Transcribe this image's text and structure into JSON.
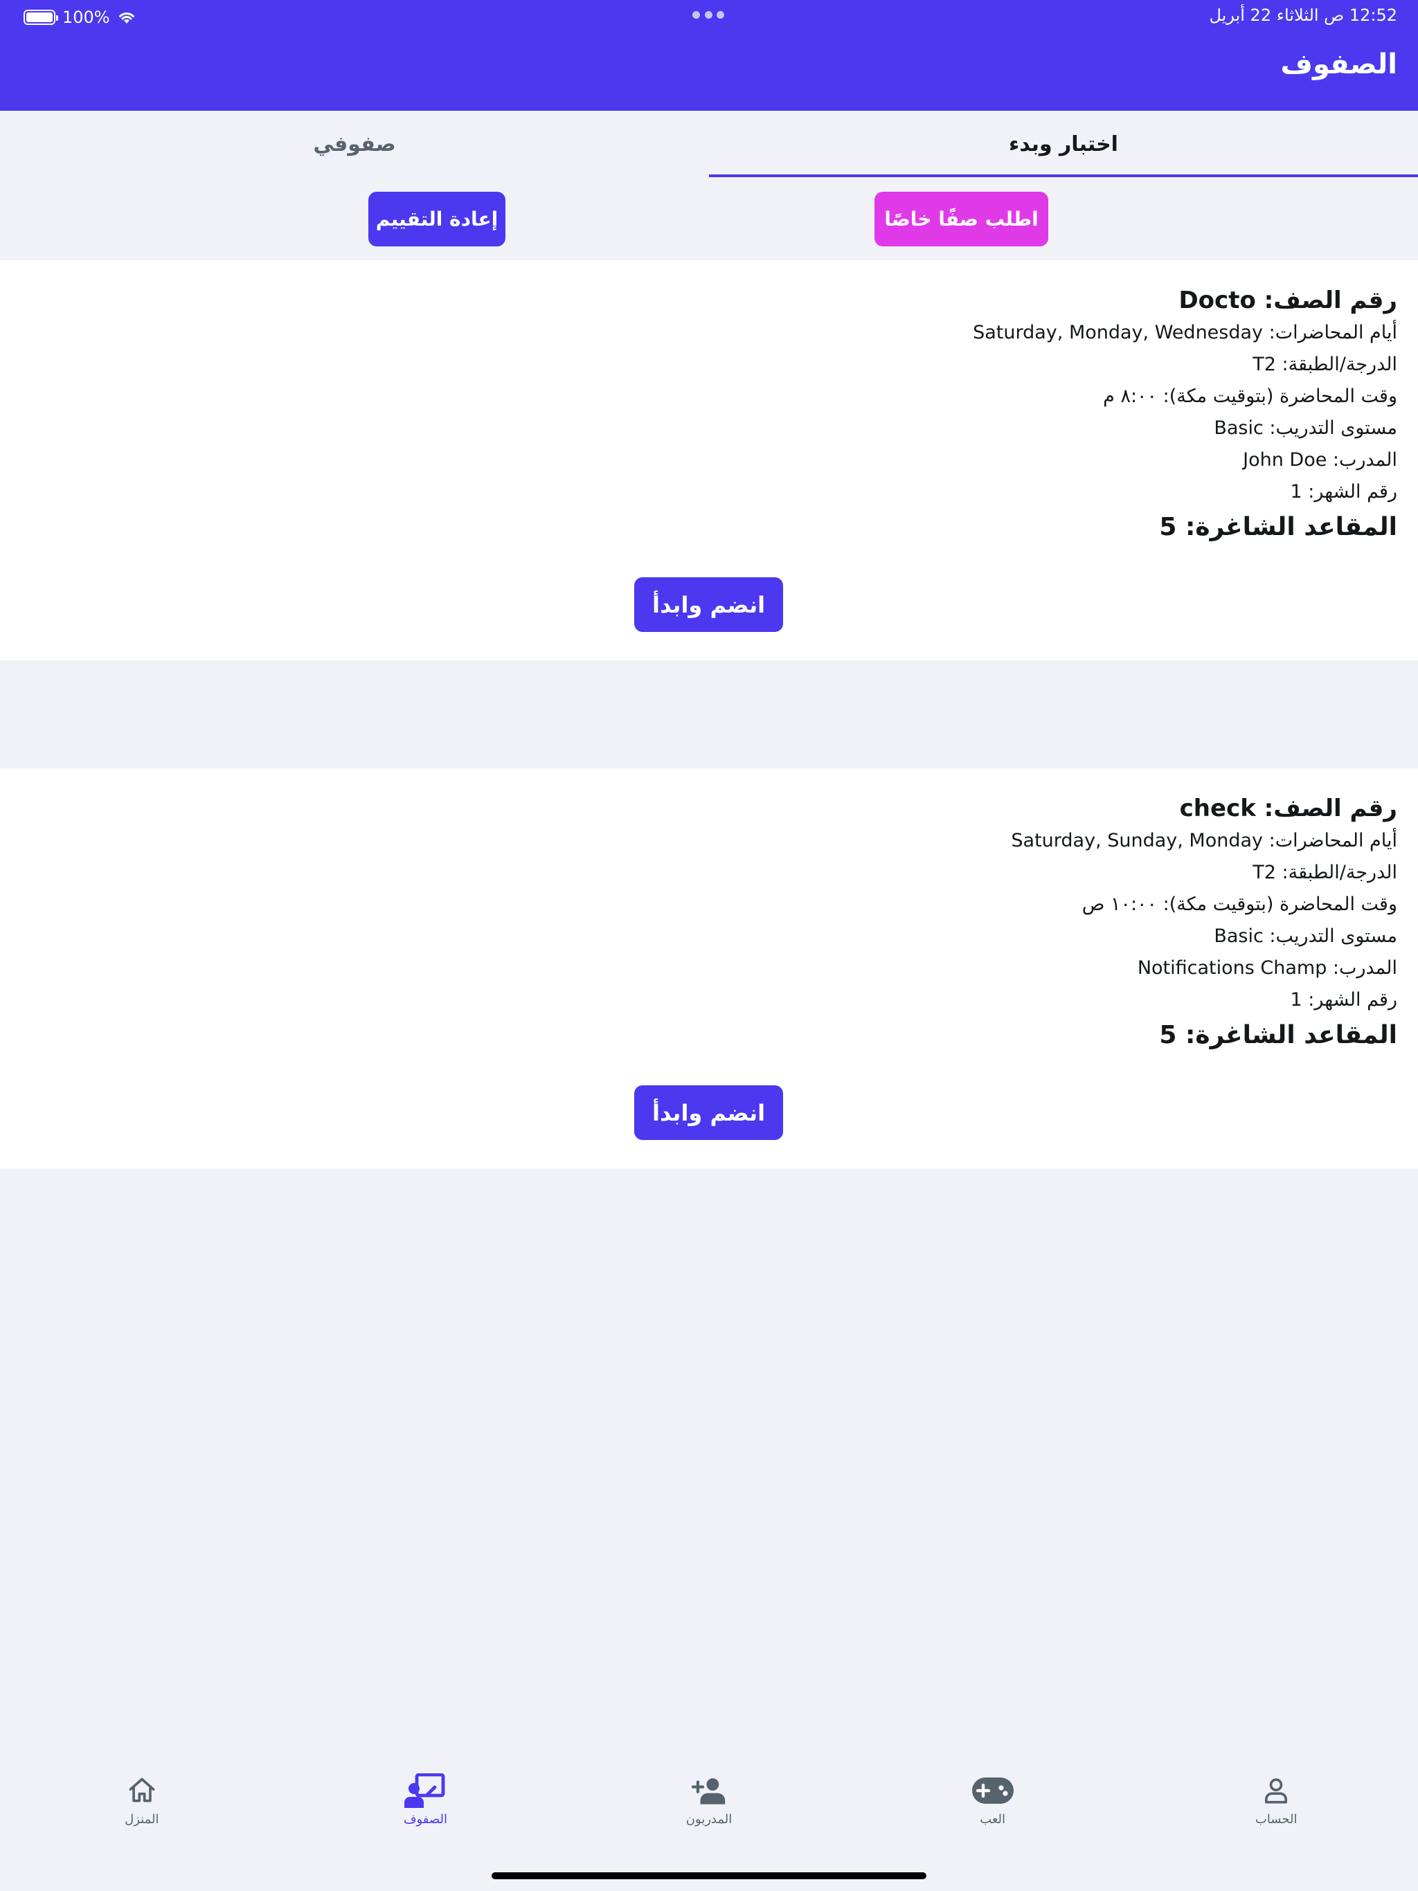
{
  "status_bar": {
    "battery": "100%",
    "time_date": "12:52 ص   الثلاثاء 22 أبريل"
  },
  "app_bar": {
    "title": "الصفوف"
  },
  "tabs": [
    {
      "label": "اختبار وبدء",
      "active": true
    },
    {
      "label": "صفوفي",
      "active": false
    }
  ],
  "actions": {
    "request_private": "اطلب صفًا خاصًا",
    "re_evaluate": "إعادة التقييم"
  },
  "classes": [
    {
      "title": "رقم الصف: Docto",
      "days": "أيام المحاضرات: Saturday, Monday, Wednesday",
      "grade": "الدرجة/الطبقة: T2",
      "time": "وقت المحاضرة (بتوقيت مكة): ٨:٠٠ م",
      "level": "مستوى التدريب: Basic",
      "trainer": "المدرب: John Doe",
      "month": "رقم الشهر: 1",
      "seats": "المقاعد الشاغرة: 5",
      "join": "انضم وابدأ"
    },
    {
      "title": "رقم الصف: check",
      "days": "أيام المحاضرات: Saturday, Sunday, Monday",
      "grade": "الدرجة/الطبقة: T2",
      "time": "وقت المحاضرة (بتوقيت مكة): ١٠:٠٠ ص",
      "level": "مستوى التدريب: Basic",
      "trainer": "المدرب: Notifications Champ",
      "month": "رقم الشهر: 1",
      "seats": "المقاعد الشاغرة: 5",
      "join": "انضم وابدأ"
    }
  ],
  "bottom_nav": [
    {
      "label": "المنزل",
      "icon": "home-icon",
      "active": false
    },
    {
      "label": "الصفوف",
      "icon": "classroom-icon",
      "active": true
    },
    {
      "label": "المدربون",
      "icon": "add-person-icon",
      "active": false
    },
    {
      "label": "العب",
      "icon": "gamepad-icon",
      "active": false
    },
    {
      "label": "الحساب",
      "icon": "person-icon",
      "active": false
    }
  ],
  "colors": {
    "primary": "#4b38ef",
    "accent": "#e03ae8",
    "background": "#f0f2f8",
    "card": "#ffffff",
    "text": "#14181b",
    "muted": "#57636c"
  }
}
